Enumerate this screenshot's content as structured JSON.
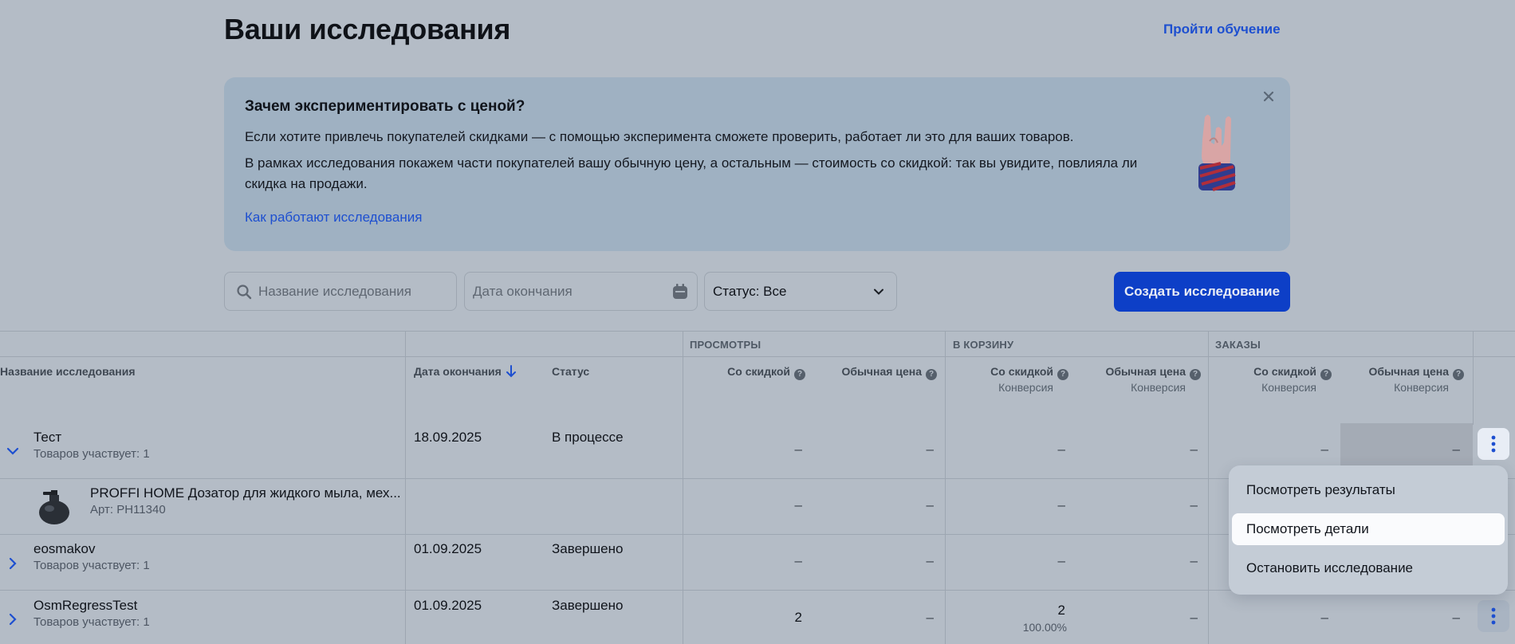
{
  "header": {
    "title": "Ваши исследования",
    "tutorial_link": "Пройти обучение"
  },
  "info_card": {
    "title": "Зачем экспериментировать с ценой?",
    "paragraph1": "Если хотите привлечь покупателей скидками — с помощью эксперимента сможете проверить, работает ли это для ваших товаров.",
    "paragraph2": "В рамках исследования покажем части покупателей вашу обычную цену, а остальным — стоимость со скидкой: так вы увидите, повлияла ли скидка на продажи.",
    "link": "Как работают исследования"
  },
  "filters": {
    "search_placeholder": "Название исследования",
    "date_placeholder": "Дата окончания",
    "status_label": "Статус: Все",
    "create_button": "Создать исследование"
  },
  "table": {
    "groups": [
      "ПРОСМОТРЫ",
      "В КОРЗИНУ",
      "ЗАКАЗЫ"
    ],
    "columns": {
      "name": "Название исследования",
      "end_date": "Дата окончания",
      "status": "Статус",
      "with_discount": "Со скидкой",
      "regular_price": "Обычная цена",
      "conversion": "Конверсия"
    },
    "rows": [
      {
        "name": "Тест",
        "sub": "Товаров участвует: 1",
        "date": "18.09.2025",
        "status": "В процессе",
        "values": [
          "–",
          "–",
          "–",
          "–",
          "–",
          "–"
        ]
      },
      {
        "name": "PROFFI HOME Дозатор для жидкого мыла, мех...",
        "sub": "Арт: PH11340",
        "values": [
          "–",
          "–",
          "–",
          "–"
        ]
      },
      {
        "name": "eosmakov",
        "sub": "Товаров участвует: 1",
        "date": "01.09.2025",
        "status": "Завершено",
        "values": [
          "–",
          "–",
          "–",
          "–"
        ]
      },
      {
        "name": "OsmRegressTest",
        "sub": "Товаров участвует: 1",
        "date": "01.09.2025",
        "status": "Завершено",
        "values": [
          "2",
          "–",
          "2",
          "–",
          "–",
          "–"
        ],
        "conversion": "100.00%"
      }
    ]
  },
  "menu": {
    "items": [
      "Посмотреть результаты",
      "Посмотреть детали",
      "Остановить исследование"
    ],
    "active_index": 1
  },
  "colors": {
    "accent": "#0d3fc7",
    "link": "#1d4fd0",
    "overlay_bg": "#b4bcc6"
  }
}
